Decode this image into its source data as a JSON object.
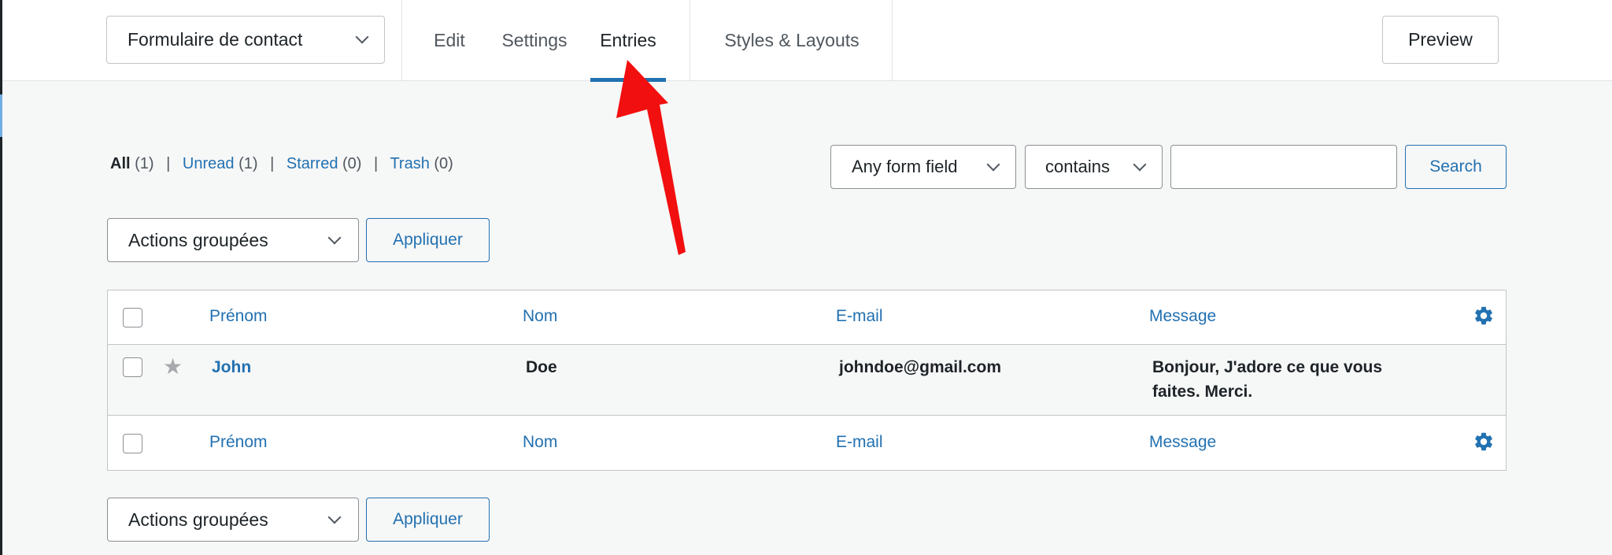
{
  "topbar": {
    "form_selector": "Formulaire de contact",
    "tabs": [
      {
        "label": "Edit"
      },
      {
        "label": "Settings"
      },
      {
        "label": "Entries",
        "active": true
      },
      {
        "label": "Styles & Layouts"
      }
    ],
    "preview_label": "Preview"
  },
  "filters": {
    "all_label": "All",
    "all_count": "(1)",
    "unread_label": "Unread",
    "unread_count": "(1)",
    "starred_label": "Starred",
    "starred_count": "(0)",
    "trash_label": "Trash",
    "trash_count": "(0)"
  },
  "search": {
    "field_select": "Any form field",
    "operator_select": "contains",
    "input_value": "",
    "button_label": "Search"
  },
  "bulk_actions": {
    "select_label": "Actions groupées",
    "apply_label": "Appliquer"
  },
  "table": {
    "columns": [
      "Prénom",
      "Nom",
      "E-mail",
      "Message"
    ],
    "rows": [
      {
        "prenom": "John",
        "nom": "Doe",
        "email": "johndoe@gmail.com",
        "message_line1": "Bonjour, J'adore ce que vous",
        "message_line2": "faites. Merci."
      }
    ]
  },
  "colors": {
    "accent": "#2271b1",
    "text": "#1d2327",
    "muted": "#50575e",
    "border": "#c3c4c7",
    "background": "#f6f7f7",
    "annotation_arrow": "#f20f0f"
  },
  "icons": {
    "form_select_chevron": "chevron-down-icon",
    "row_star": "star-icon",
    "column_settings": "gear-icon",
    "annotation": "red-arrow-pointer"
  }
}
